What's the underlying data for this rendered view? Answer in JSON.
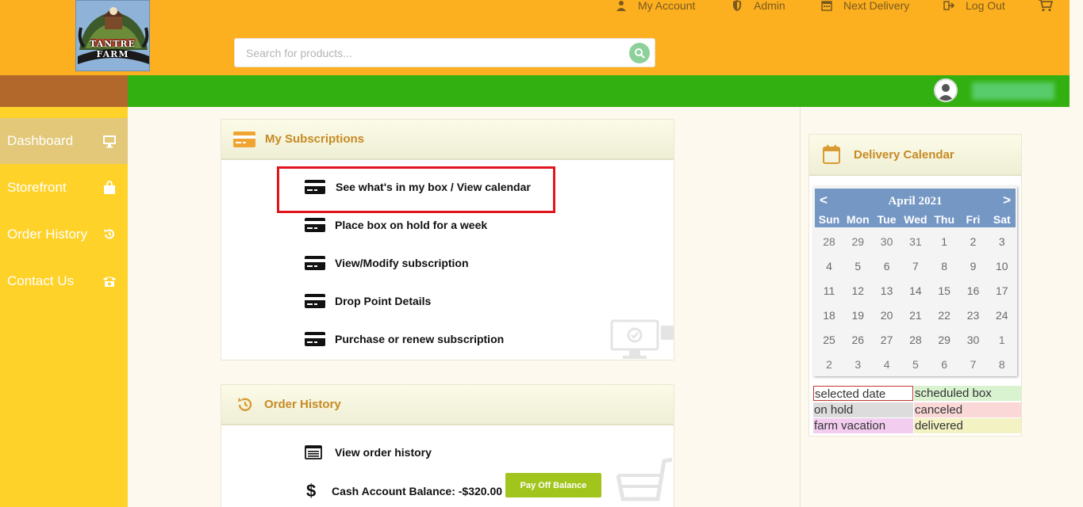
{
  "header": {
    "logo_text": "TANTRE FARM",
    "search_placeholder": "Search for products...",
    "nav": [
      {
        "label": "My Account",
        "icon": "user-icon"
      },
      {
        "label": "Admin",
        "icon": "shield-icon"
      },
      {
        "label": "Next Delivery",
        "icon": "calendar-icon"
      },
      {
        "label": "Log Out",
        "icon": "logout-icon"
      }
    ],
    "cart_icon": "cart-icon"
  },
  "sidebar": {
    "items": [
      {
        "label": "Dashboard",
        "icon": "monitor-icon",
        "active": true
      },
      {
        "label": "Storefront",
        "icon": "shopping-bag-icon"
      },
      {
        "label": "Order History",
        "icon": "history-icon"
      },
      {
        "label": "Contact Us",
        "icon": "telephone-icon"
      }
    ]
  },
  "subscriptions": {
    "title": "My Subscriptions",
    "items": [
      "See what's in my box / View calendar",
      "Place box on hold for a week",
      "View/Modify subscription",
      "Drop Point Details",
      "Purchase or renew subscription"
    ]
  },
  "order_history": {
    "title": "Order History",
    "view_label": "View order history",
    "balance_label": "Cash Account Balance: -$320.00",
    "pay_button": "Pay Off Balance"
  },
  "delivery_calendar": {
    "title": "Delivery Calendar",
    "month": "April 2021",
    "prev": "<",
    "next": ">",
    "weekdays": [
      "Sun",
      "Mon",
      "Tue",
      "Wed",
      "Thu",
      "Fri",
      "Sat"
    ],
    "weeks": [
      [
        "28",
        "29",
        "30",
        "31",
        "1",
        "2",
        "3"
      ],
      [
        "4",
        "5",
        "6",
        "7",
        "8",
        "9",
        "10"
      ],
      [
        "11",
        "12",
        "13",
        "14",
        "15",
        "16",
        "17"
      ],
      [
        "18",
        "19",
        "20",
        "21",
        "22",
        "23",
        "24"
      ],
      [
        "25",
        "26",
        "27",
        "28",
        "29",
        "30",
        "1"
      ],
      [
        "2",
        "3",
        "4",
        "5",
        "6",
        "7",
        "8"
      ]
    ],
    "legend": [
      {
        "label": "selected date",
        "color": "#ffffff",
        "border": "#c0392b"
      },
      {
        "label": "scheduled box",
        "color": "#d9f2cf"
      },
      {
        "label": "on hold",
        "color": "#dcdcdc"
      },
      {
        "label": "canceled",
        "color": "#fbd8d8"
      },
      {
        "label": "farm vacation",
        "color": "#f2cdef"
      },
      {
        "label": "delivered",
        "color": "#f2f2c3"
      }
    ]
  },
  "colors": {
    "header": "#fcaf1f",
    "green_bar": "#33b011",
    "sidebar": "#ffd229",
    "accent": "#c78a23",
    "highlight": "#e1161c"
  }
}
